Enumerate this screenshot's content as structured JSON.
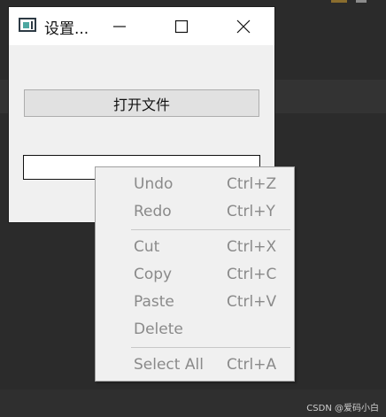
{
  "window": {
    "title": "设置...",
    "open_button_label": "打开文件",
    "text_field_value": ""
  },
  "context_menu": {
    "items": [
      {
        "label": "Undo",
        "shortcut": "Ctrl+Z",
        "enabled": false
      },
      {
        "label": "Redo",
        "shortcut": "Ctrl+Y",
        "enabled": false
      },
      {
        "label": "Cut",
        "shortcut": "Ctrl+X",
        "enabled": false
      },
      {
        "label": "Copy",
        "shortcut": "Ctrl+C",
        "enabled": false
      },
      {
        "label": "Paste",
        "shortcut": "Ctrl+V",
        "enabled": false
      },
      {
        "label": "Delete",
        "shortcut": "",
        "enabled": false
      },
      {
        "label": "Select All",
        "shortcut": "Ctrl+A",
        "enabled": false
      }
    ]
  },
  "watermark": "CSDN @爱码小白",
  "icons": [
    "app-icon",
    "minimize-icon",
    "maximize-icon",
    "close-icon"
  ],
  "colors": {
    "background": "#2b2b2b",
    "window": "#f0f0f0",
    "disabled_text": "#8a8a8a"
  }
}
